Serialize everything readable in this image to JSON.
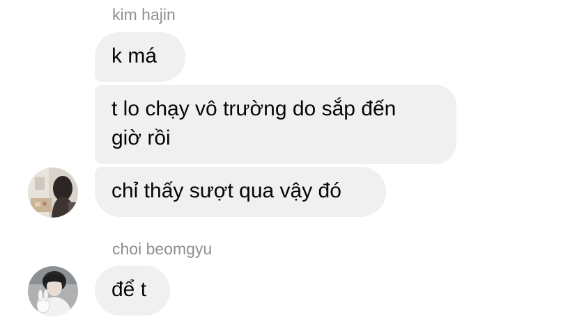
{
  "conversation": {
    "groups": [
      {
        "sender": "kim hajin",
        "messages": [
          {
            "lines": [
              "k má"
            ]
          },
          {
            "lines": [
              "t lo chạy vô trường do sắp đến",
              "giờ rồi"
            ]
          },
          {
            "lines": [
              "chỉ thấy sượt qua vậy đó"
            ]
          }
        ],
        "avatar_icon": "user-photo-avatar-icon"
      },
      {
        "sender": "choi beomgyu",
        "messages": [
          {
            "lines": [
              "để t"
            ]
          }
        ],
        "avatar_icon": "user-photo-avatar-icon"
      }
    ]
  },
  "colors": {
    "bubble_background": "#f0f0f0",
    "sender_name": "#8e8e93",
    "message_text": "#050505",
    "page_background": "#ffffff"
  }
}
